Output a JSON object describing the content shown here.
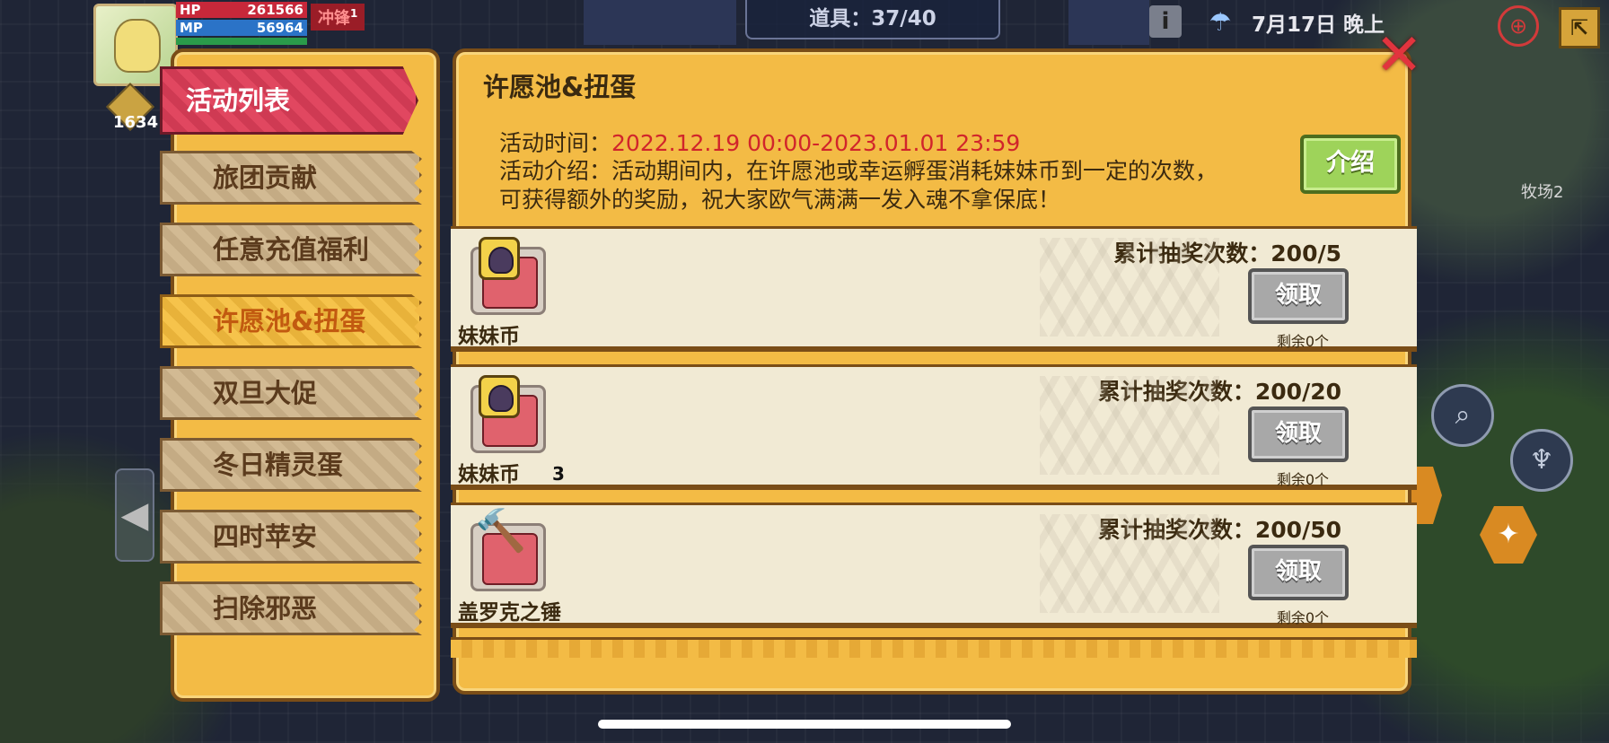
{
  "hud": {
    "hp_label": "HP",
    "hp_value": "261566",
    "mp_label": "MP",
    "mp_value": "56964",
    "charge_label": "冲锋",
    "charge_count": "1",
    "level": "1634",
    "items": "道具：37/40",
    "date": "7月17日 晚上",
    "map_name": "牧场2"
  },
  "menu": {
    "title": "活动列表",
    "items": [
      {
        "label": "旅团贡献",
        "active": false
      },
      {
        "label": "任意充值福利",
        "active": false
      },
      {
        "label": "许愿池&扭蛋",
        "active": true
      },
      {
        "label": "双旦大促",
        "active": false
      },
      {
        "label": "冬日精灵蛋",
        "active": false
      },
      {
        "label": "四时苹安",
        "active": false
      },
      {
        "label": "扫除邪恶",
        "active": false
      }
    ]
  },
  "event": {
    "title": "许愿池&扭蛋",
    "time_label": "活动时间：",
    "time_value": "2022.12.19 00:00-2023.01.01 23:59",
    "desc_line1": "活动介绍：活动期间内，在许愿池或幸运孵蛋消耗妹妹币到一定的次数，",
    "desc_line2": "可获得额外的奖励，祝大家欧气满满一发入魂不拿保底！",
    "intro_button": "介绍"
  },
  "rewards": [
    {
      "item_name": "妹妹币",
      "item_icon": "sister-coin-icon",
      "count": "",
      "progress": "累计抽奖次数：200/5",
      "button": "领取",
      "remain": "剩余0个"
    },
    {
      "item_name": "妹妹币",
      "item_icon": "sister-coin-icon",
      "count": "3",
      "progress": "累计抽奖次数：200/20",
      "button": "领取",
      "remain": "剩余0个"
    },
    {
      "item_name": "盖罗克之锤",
      "item_icon": "hammer-icon",
      "count": "",
      "progress": "累计抽奖次数：200/50",
      "button": "领取",
      "remain": "剩余0个"
    }
  ],
  "colors": {
    "panel": "#f3bb45",
    "panel_border": "#7a4d17",
    "active_tab_text": "#c25a10",
    "time_text": "#d1252b",
    "intro_button": "#9ed35a",
    "claim_button_disabled": "#a8a8a8",
    "close_button": "#e2343e"
  }
}
